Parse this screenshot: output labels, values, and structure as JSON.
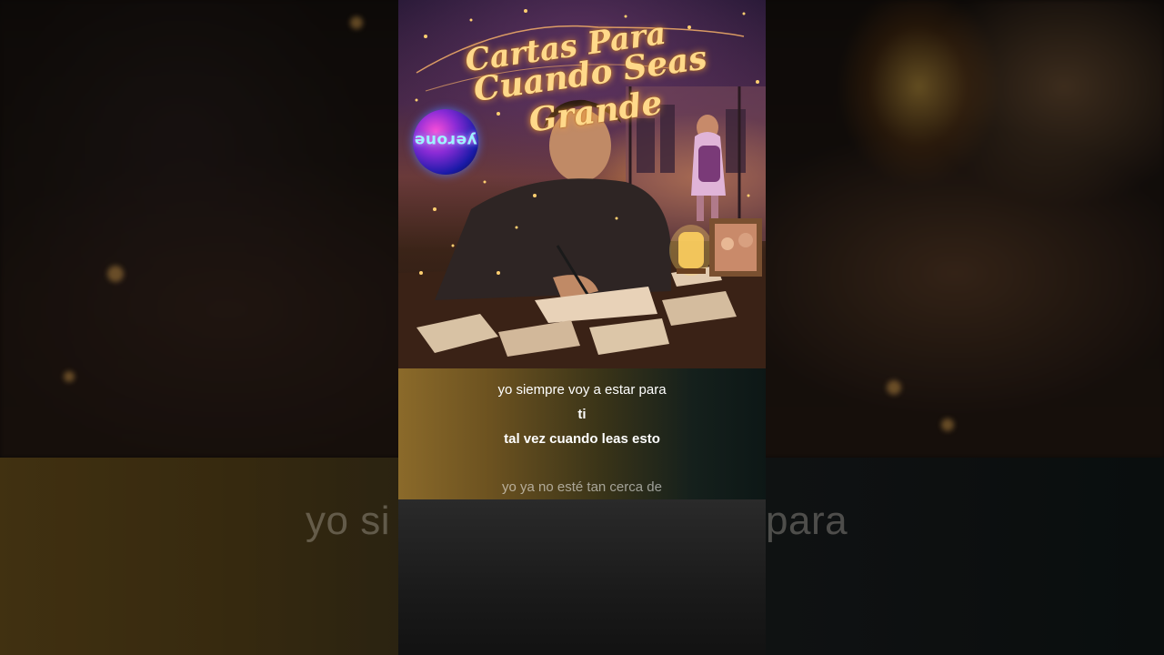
{
  "cover": {
    "title_line_1": "Cartas Para",
    "title_line_2": "Cuando Seas Grande",
    "channel_logo_text": "yerone"
  },
  "lyrics": {
    "line_1": "yo siempre voy a estar para",
    "line_2": "ti",
    "line_3": "tal vez cuando leas esto",
    "line_4": "yo ya no esté tan cerca de"
  },
  "backdrop": {
    "blurred_lyric_left": "yo si",
    "blurred_lyric_right": "para"
  },
  "colors": {
    "title_gold": "#ffd98a",
    "lyric_text": "#ffffff",
    "panel_gold": "#8b6a2a",
    "panel_dark": "#0d1716"
  }
}
